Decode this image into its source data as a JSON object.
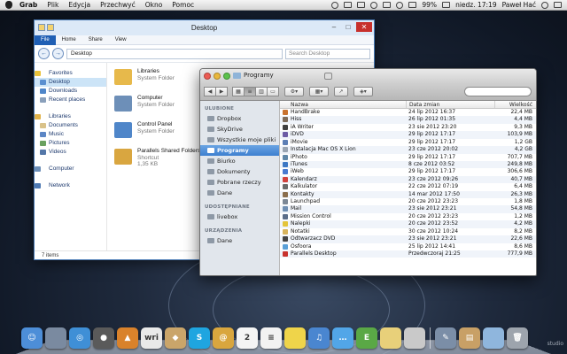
{
  "menubar": {
    "items": [
      "Grab",
      "Plik",
      "Edycja",
      "Przechwyć",
      "Okno",
      "Pomoc"
    ],
    "battery": "99%",
    "clock": "niedz. 17:19",
    "user": "Paweł Hać"
  },
  "explorer": {
    "title": "Desktop",
    "ribbon_tabs": [
      "File",
      "Home",
      "Share",
      "View"
    ],
    "address": "Desktop",
    "search_placeholder": "Search Desktop",
    "sidebar": {
      "favorites_header": "Favorites",
      "favorites": [
        "Desktop",
        "Downloads",
        "Recent places"
      ],
      "libraries_header": "Libraries",
      "libraries": [
        "Documents",
        "Music",
        "Pictures",
        "Videos"
      ],
      "computer": "Computer",
      "network": "Network"
    },
    "files": [
      {
        "name": "Libraries",
        "sub1": "System Folder",
        "sub2": "",
        "color": "#e7b94b"
      },
      {
        "name": "Computer",
        "sub1": "System Folder",
        "sub2": "",
        "color": "#6d8fb8"
      },
      {
        "name": "Control Panel",
        "sub1": "System Folder",
        "sub2": "",
        "color": "#4f86c9"
      },
      {
        "name": "Parallels Shared Folders",
        "sub1": "Shortcut",
        "sub2": "1,35 KB",
        "color": "#d9a640"
      }
    ],
    "status": "7 items"
  },
  "finder": {
    "title": "Programy",
    "sidebar": {
      "favorites_header": "ULUBIONE",
      "favorites": [
        "Dropbox",
        "SkyDrive",
        "Wszystkie moje pliki",
        "Programy",
        "Biurko",
        "Dokumenty",
        "Pobrane rzeczy",
        "Dane"
      ],
      "shared_header": "UDOSTĘPNIANE",
      "shared": [
        "livebox"
      ],
      "devices_header": "URZĄDZENIA",
      "devices": [
        "Dane"
      ]
    },
    "columns": {
      "name": "Nazwa",
      "date": "Data zmian",
      "size": "Wielkość"
    },
    "rows": [
      {
        "name": "HandBrake",
        "date": "24 lip 2012 16:37",
        "size": "22,4 MB",
        "color": "#c9732f"
      },
      {
        "name": "Hiss",
        "date": "26 lip 2012 01:35",
        "size": "4,4 MB",
        "color": "#7e6c5a"
      },
      {
        "name": "iA Writer",
        "date": "23 sie 2012 23:20",
        "size": "9,3 MB",
        "color": "#3f3f3f"
      },
      {
        "name": "iDVD",
        "date": "29 lip 2012 17:17",
        "size": "103,9 MB",
        "color": "#6b5ba5"
      },
      {
        "name": "iMovie",
        "date": "29 lip 2012 17:17",
        "size": "1,2 GB",
        "color": "#5d7fb5"
      },
      {
        "name": "Instalacja Mac OS X Lion",
        "date": "23 cze 2012 20:02",
        "size": "4,2 GB",
        "color": "#9aa5b2"
      },
      {
        "name": "iPhoto",
        "date": "29 lip 2012 17:17",
        "size": "707,7 MB",
        "color": "#5f87a8"
      },
      {
        "name": "iTunes",
        "date": "8 cze 2012 03:52",
        "size": "249,8 MB",
        "color": "#3c78c4"
      },
      {
        "name": "iWeb",
        "date": "29 lip 2012 17:17",
        "size": "306,6 MB",
        "color": "#4a7bd0"
      },
      {
        "name": "Kalendarz",
        "date": "23 cze 2012 09:26",
        "size": "40,7 MB",
        "color": "#d2423c"
      },
      {
        "name": "Kalkulator",
        "date": "22 cze 2012 07:19",
        "size": "6,4 MB",
        "color": "#6b6b6b"
      },
      {
        "name": "Kontakty",
        "date": "14 mar 2012 17:50",
        "size": "26,3 MB",
        "color": "#8a6e4d"
      },
      {
        "name": "Launchpad",
        "date": "20 cze 2012 23:23",
        "size": "1,8 MB",
        "color": "#7c8896"
      },
      {
        "name": "Mail",
        "date": "23 sie 2012 23:21",
        "size": "54,8 MB",
        "color": "#6f8fb3"
      },
      {
        "name": "Mission Control",
        "date": "20 cze 2012 23:23",
        "size": "1,2 MB",
        "color": "#5b6e8a"
      },
      {
        "name": "Nalepki",
        "date": "20 cze 2012 23:52",
        "size": "4,2 MB",
        "color": "#e3c43a"
      },
      {
        "name": "Notatki",
        "date": "30 cze 2012 10:24",
        "size": "8,2 MB",
        "color": "#d8b45d"
      },
      {
        "name": "Odtwarzacz DVD",
        "date": "23 sie 2012 23:21",
        "size": "22,6 MB",
        "color": "#444"
      },
      {
        "name": "Osfoora",
        "date": "25 lip 2012 14:41",
        "size": "8,6 MB",
        "color": "#5aa0d8"
      },
      {
        "name": "Parallels Desktop",
        "date": "Przedwczoraj 21:25",
        "size": "777,9 MB",
        "color": "#c8322d"
      }
    ]
  },
  "dock": {
    "label": "studio",
    "icons": [
      {
        "name": "finder",
        "glyph": "☺",
        "color": "#4d8ed8"
      },
      {
        "name": "preview",
        "glyph": "",
        "color": "#7a8aa0"
      },
      {
        "name": "safari",
        "glyph": "◎",
        "color": "#3f8fd6"
      },
      {
        "name": "camera",
        "glyph": "●",
        "color": "#5a5a5a"
      },
      {
        "name": "transmit",
        "glyph": "▲",
        "color": "#d9822b"
      },
      {
        "name": "wri",
        "glyph": "wri",
        "color": "#e9e9e9"
      },
      {
        "name": "stuffit",
        "glyph": "◆",
        "color": "#caa56a"
      },
      {
        "name": "skype",
        "glyph": "S",
        "color": "#1fa5e0"
      },
      {
        "name": "address",
        "glyph": "@",
        "color": "#d9a63e"
      },
      {
        "name": "calendar",
        "glyph": "2",
        "color": "#f4f4f4"
      },
      {
        "name": "reminders",
        "glyph": "≡",
        "color": "#f2f2f2"
      },
      {
        "name": "stickies",
        "glyph": "",
        "color": "#efd44a"
      },
      {
        "name": "itunes",
        "glyph": "♫",
        "color": "#4a86d0"
      },
      {
        "name": "messages",
        "glyph": "…",
        "color": "#52a6e8"
      },
      {
        "name": "evernote",
        "glyph": "E",
        "color": "#5aa846"
      },
      {
        "name": "notes",
        "glyph": "",
        "color": "#e8d07a"
      },
      {
        "name": "photo",
        "glyph": "",
        "color": "#c9c9c9"
      },
      {
        "name": "utilities",
        "glyph": "✎",
        "color": "#7b8ea7"
      },
      {
        "name": "archive",
        "glyph": "▤",
        "color": "#c8a066"
      },
      {
        "name": "folder",
        "glyph": "",
        "color": "#8fb6dd"
      },
      {
        "name": "trash",
        "glyph": "🗑",
        "color": "#9da4ad"
      }
    ]
  }
}
